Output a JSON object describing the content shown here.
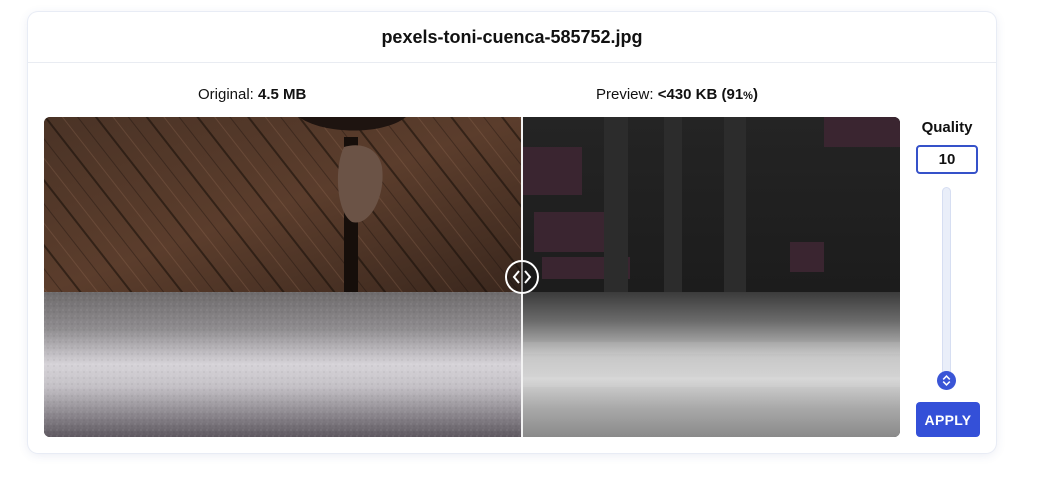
{
  "file": {
    "name": "pexels-toni-cuenca-585752.jpg"
  },
  "original": {
    "label": "Original:",
    "size": "4.5 MB"
  },
  "preview": {
    "label": "Preview:",
    "size": "<430 KB (91",
    "percent_sign": "%",
    "close": ")"
  },
  "quality": {
    "label": "Quality",
    "value": "10",
    "min": 0,
    "max": 100
  },
  "apply_label": "APPLY",
  "colors": {
    "accent": "#3450d8",
    "border": "#3551c9"
  },
  "icons": {
    "divider": "chevrons-left-right-icon",
    "slider": "chevrons-up-down-icon"
  }
}
